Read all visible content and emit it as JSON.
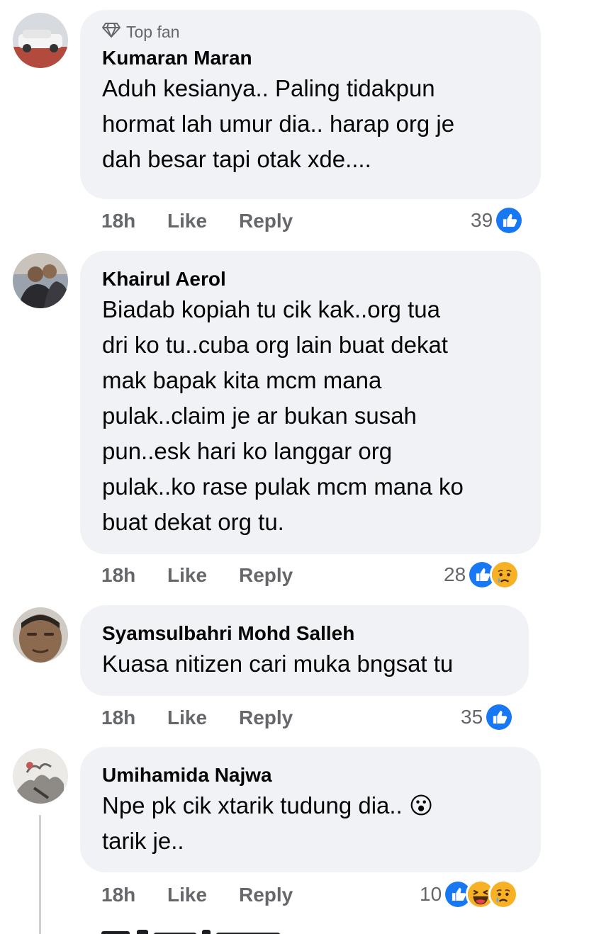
{
  "comments": [
    {
      "badge": "Top fan",
      "author": "Kumaran Maran",
      "text": "Aduh kesianya.. Paling tidakpun\nhormat lah umur dia.. harap org je\ndah besar tapi otak xde....",
      "time": "18h",
      "like": "Like",
      "reply": "Reply",
      "reaction_count": "39",
      "reactions": [
        "like-icon"
      ]
    },
    {
      "author": "Khairul Aerol",
      "text": "Biadab kopiah tu cik kak..org tua\ndri ko tu..cuba org lain buat dekat\nmak bapak kita mcm mana\npulak..claim je ar bukan susah\npun..esk hari ko langgar org\npulak..ko rase pulak mcm mana ko\nbuat dekat org tu.",
      "time": "18h",
      "like": "Like",
      "reply": "Reply",
      "reaction_count": "28",
      "reactions": [
        "like-icon",
        "sad-icon"
      ]
    },
    {
      "author": "Syamsulbahri Mohd Salleh",
      "text": "Kuasa nitizen cari muka bngsat tu",
      "time": "18h",
      "like": "Like",
      "reply": "Reply",
      "reaction_count": "35",
      "reactions": [
        "like-icon"
      ]
    },
    {
      "author": "Umihamida Najwa",
      "text": "Npe pk cik xtarik tudung dia.. 😮\ntarik je..",
      "time": "18h",
      "like": "Like",
      "reply": "Reply",
      "reaction_count": "10",
      "reactions": [
        "like-icon",
        "haha-icon",
        "sad-icon"
      ]
    }
  ],
  "colors": {
    "bubble": "#f0f2f5",
    "like_blue": "#1877f2",
    "meta_gray": "#65676b",
    "emoji_yellow": "#f7b125"
  }
}
